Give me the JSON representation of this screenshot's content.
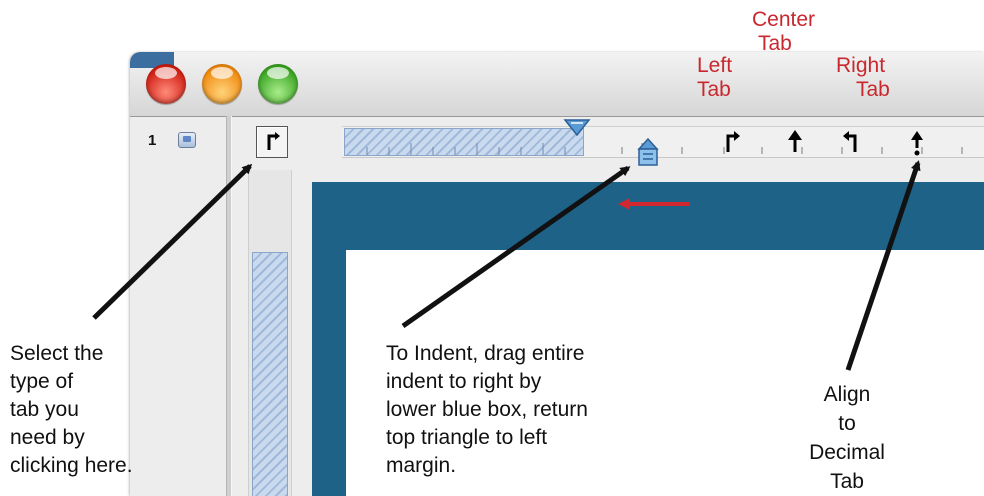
{
  "window": {
    "page_number": "1"
  },
  "tab_labels": {
    "center": [
      "Center",
      "Tab"
    ],
    "left": [
      "Left",
      "Tab"
    ],
    "right": [
      "Right",
      "Tab"
    ]
  },
  "annotations": {
    "select_tab": [
      "Select the",
      "type of",
      "tab you",
      "need by",
      "clicking here."
    ],
    "indent": [
      "To Indent, drag entire",
      "indent to right by",
      "lower blue box, return",
      "top triangle to left",
      "margin."
    ],
    "decimal": [
      "Align",
      "to",
      "Decimal",
      "Tab"
    ]
  },
  "colors": {
    "annotation_red": "#c8282e",
    "content_blue": "#1f6288",
    "ruler_hatch": "#9fb9da",
    "indent_marker": "#5b9bd5"
  },
  "icons": {
    "tab_selector": "left-tab-icon",
    "tab_markers": [
      "left-tab-icon",
      "center-tab-icon",
      "right-tab-icon",
      "decimal-tab-icon"
    ],
    "first_line_indent": "indent-triangle-icon",
    "left_indent": "indent-box-icon"
  }
}
